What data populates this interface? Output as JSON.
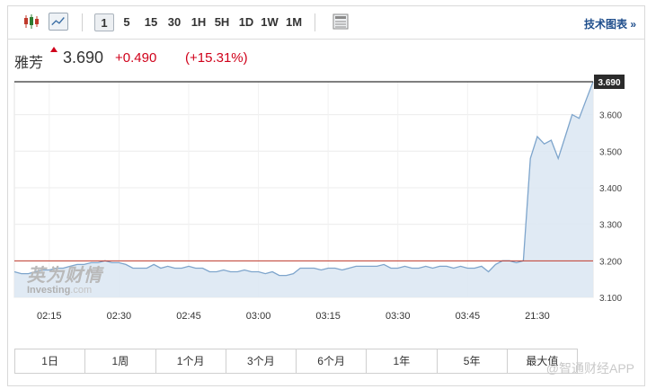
{
  "toolbar": {
    "periods": [
      "1",
      "5",
      "15",
      "30",
      "1H",
      "5H",
      "1D",
      "1W",
      "1M"
    ],
    "active_period": "1",
    "tech_link": "技术图表 »"
  },
  "quote": {
    "name": "雅芳",
    "price": "3.690",
    "change": "+0.490",
    "change_pct": "(+15.31%)"
  },
  "watermark_logo": {
    "cn": "英为财情",
    "en_brand": "Investing",
    "en_domain": ".com"
  },
  "range_buttons": [
    "1日",
    "1周",
    "1个月",
    "3个月",
    "6个月",
    "1年",
    "5年",
    "最大值"
  ],
  "app_watermark": "@智通财经APP",
  "colors": {
    "accent_red": "#d0021b",
    "line": "#7ea5cc",
    "area": "#dde8f3",
    "ref_line": "#c0392b"
  },
  "chart_data": {
    "type": "area",
    "x_ticks": [
      "02:15",
      "02:30",
      "02:45",
      "03:00",
      "03:15",
      "03:30",
      "03:45",
      "21:30"
    ],
    "y_ticks": [
      "3.100",
      "3.200",
      "3.300",
      "3.400",
      "3.500",
      "3.600",
      "3.690"
    ],
    "ylim": [
      3.1,
      3.69
    ],
    "reference_line": 3.2,
    "last_price_label": "3.690",
    "grid": true,
    "values": [
      3.17,
      3.165,
      3.165,
      3.17,
      3.175,
      3.175,
      3.18,
      3.18,
      3.185,
      3.19,
      3.19,
      3.195,
      3.195,
      3.2,
      3.195,
      3.195,
      3.19,
      3.18,
      3.18,
      3.18,
      3.19,
      3.18,
      3.185,
      3.18,
      3.18,
      3.185,
      3.18,
      3.18,
      3.17,
      3.17,
      3.175,
      3.17,
      3.17,
      3.175,
      3.17,
      3.17,
      3.165,
      3.17,
      3.16,
      3.16,
      3.165,
      3.18,
      3.18,
      3.18,
      3.175,
      3.18,
      3.18,
      3.175,
      3.18,
      3.185,
      3.185,
      3.185,
      3.185,
      3.19,
      3.18,
      3.18,
      3.185,
      3.18,
      3.18,
      3.185,
      3.18,
      3.185,
      3.185,
      3.18,
      3.185,
      3.18,
      3.18,
      3.185,
      3.17,
      3.19,
      3.2,
      3.2,
      3.195,
      3.2,
      3.48,
      3.54,
      3.52,
      3.53,
      3.48,
      3.54,
      3.6,
      3.59,
      3.64,
      3.69
    ]
  }
}
